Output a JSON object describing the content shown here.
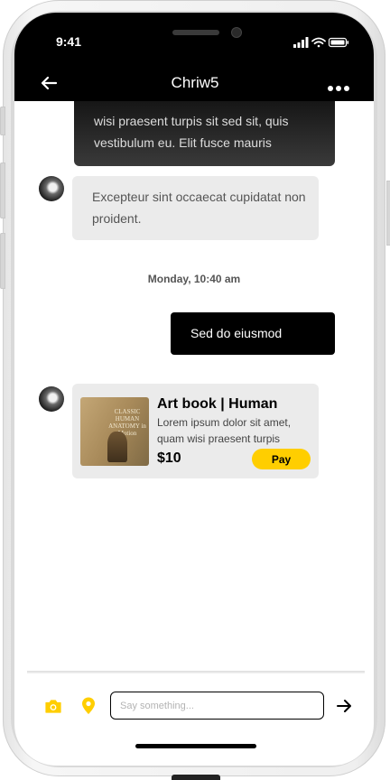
{
  "status_bar": {
    "time": "9:41"
  },
  "header": {
    "title": "Chriw5"
  },
  "messages": {
    "partial_received": "wisi praesent turpis sit sed sit, quis vestibulum eu. Elit fusce mauris",
    "received_text": "Excepteur sint occaecat cupidatat non proident.",
    "day_stamp": "Monday, 10:40 am",
    "sent_text": "Sed do eiusmod"
  },
  "product_card": {
    "cover_lettering": "CLASSIC HUMAN ANATOMY in Motion",
    "title": "Art book | Human",
    "description": "Lorem ipsum dolor sit amet, quam wisi praesent turpis",
    "price": "$10",
    "pay_label": "Pay"
  },
  "composer": {
    "placeholder": "Say something..."
  },
  "colors": {
    "accent": "#FFCE00",
    "header_bg": "#000000",
    "bubble_grey": "#EBEBEB"
  },
  "icons": [
    "back-arrow-icon",
    "more-icon",
    "camera-icon",
    "location-pin-icon",
    "send-arrow-icon"
  ]
}
